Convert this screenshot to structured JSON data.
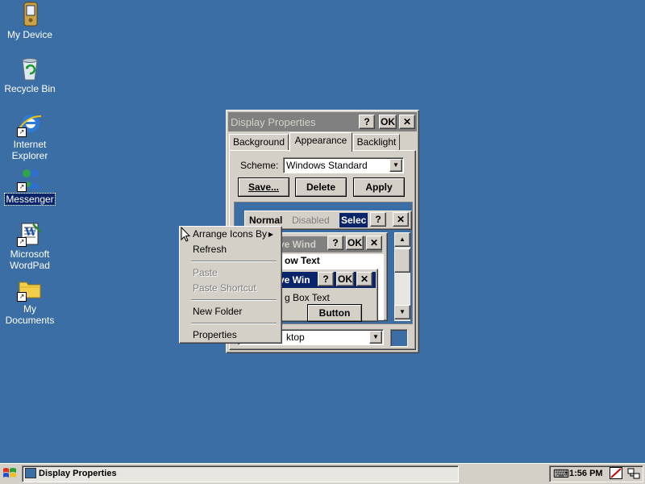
{
  "desktop": {
    "icons": [
      {
        "label": "My Device",
        "icon": "pda-icon"
      },
      {
        "label": "Recycle Bin",
        "icon": "recycle-bin-icon"
      },
      {
        "label": "Internet Explorer",
        "icon": "internet-explorer-icon"
      },
      {
        "label": "Messenger",
        "icon": "messenger-icon"
      },
      {
        "label": "Microsoft WordPad",
        "icon": "wordpad-icon"
      },
      {
        "label": "My Documents",
        "icon": "folder-icon"
      }
    ]
  },
  "dialog": {
    "title": "Display Properties",
    "help_label": "?",
    "ok_label": "OK",
    "close_label": "✕",
    "tabs": [
      "Background",
      "Appearance",
      "Backlight"
    ],
    "active_tab": "Appearance",
    "scheme_label": "Scheme:",
    "scheme_value": "Windows Standard",
    "buttons": {
      "save": "Save...",
      "delete": "Delete",
      "apply": "Apply"
    },
    "preview": {
      "normal": "Normal",
      "disabled": "Disabled",
      "selected": "Selec",
      "inactive_window": "ve Wind",
      "window_text": "ow Text",
      "active_window": "ve Win",
      "dialog_text": "g Box Text",
      "button": "Button"
    },
    "item_value": "ktop",
    "color_swatch": "#3a6ea5"
  },
  "context_menu": {
    "items": [
      {
        "label": "Arrange Icons By",
        "disabled": false,
        "submenu": true
      },
      {
        "label": "Refresh",
        "disabled": false
      },
      {
        "label": "Paste",
        "disabled": true
      },
      {
        "label": "Paste Shortcut",
        "disabled": true
      },
      {
        "label": "New Folder",
        "disabled": false
      },
      {
        "label": "Properties",
        "disabled": false
      }
    ]
  },
  "taskbar": {
    "task_label": "Display Properties",
    "time": "1:56 PM"
  },
  "colors": {
    "desktop": "#3a6ea5",
    "face": "#d4d0c8",
    "active_title": "#0a246a",
    "inactive_title": "#808080"
  }
}
